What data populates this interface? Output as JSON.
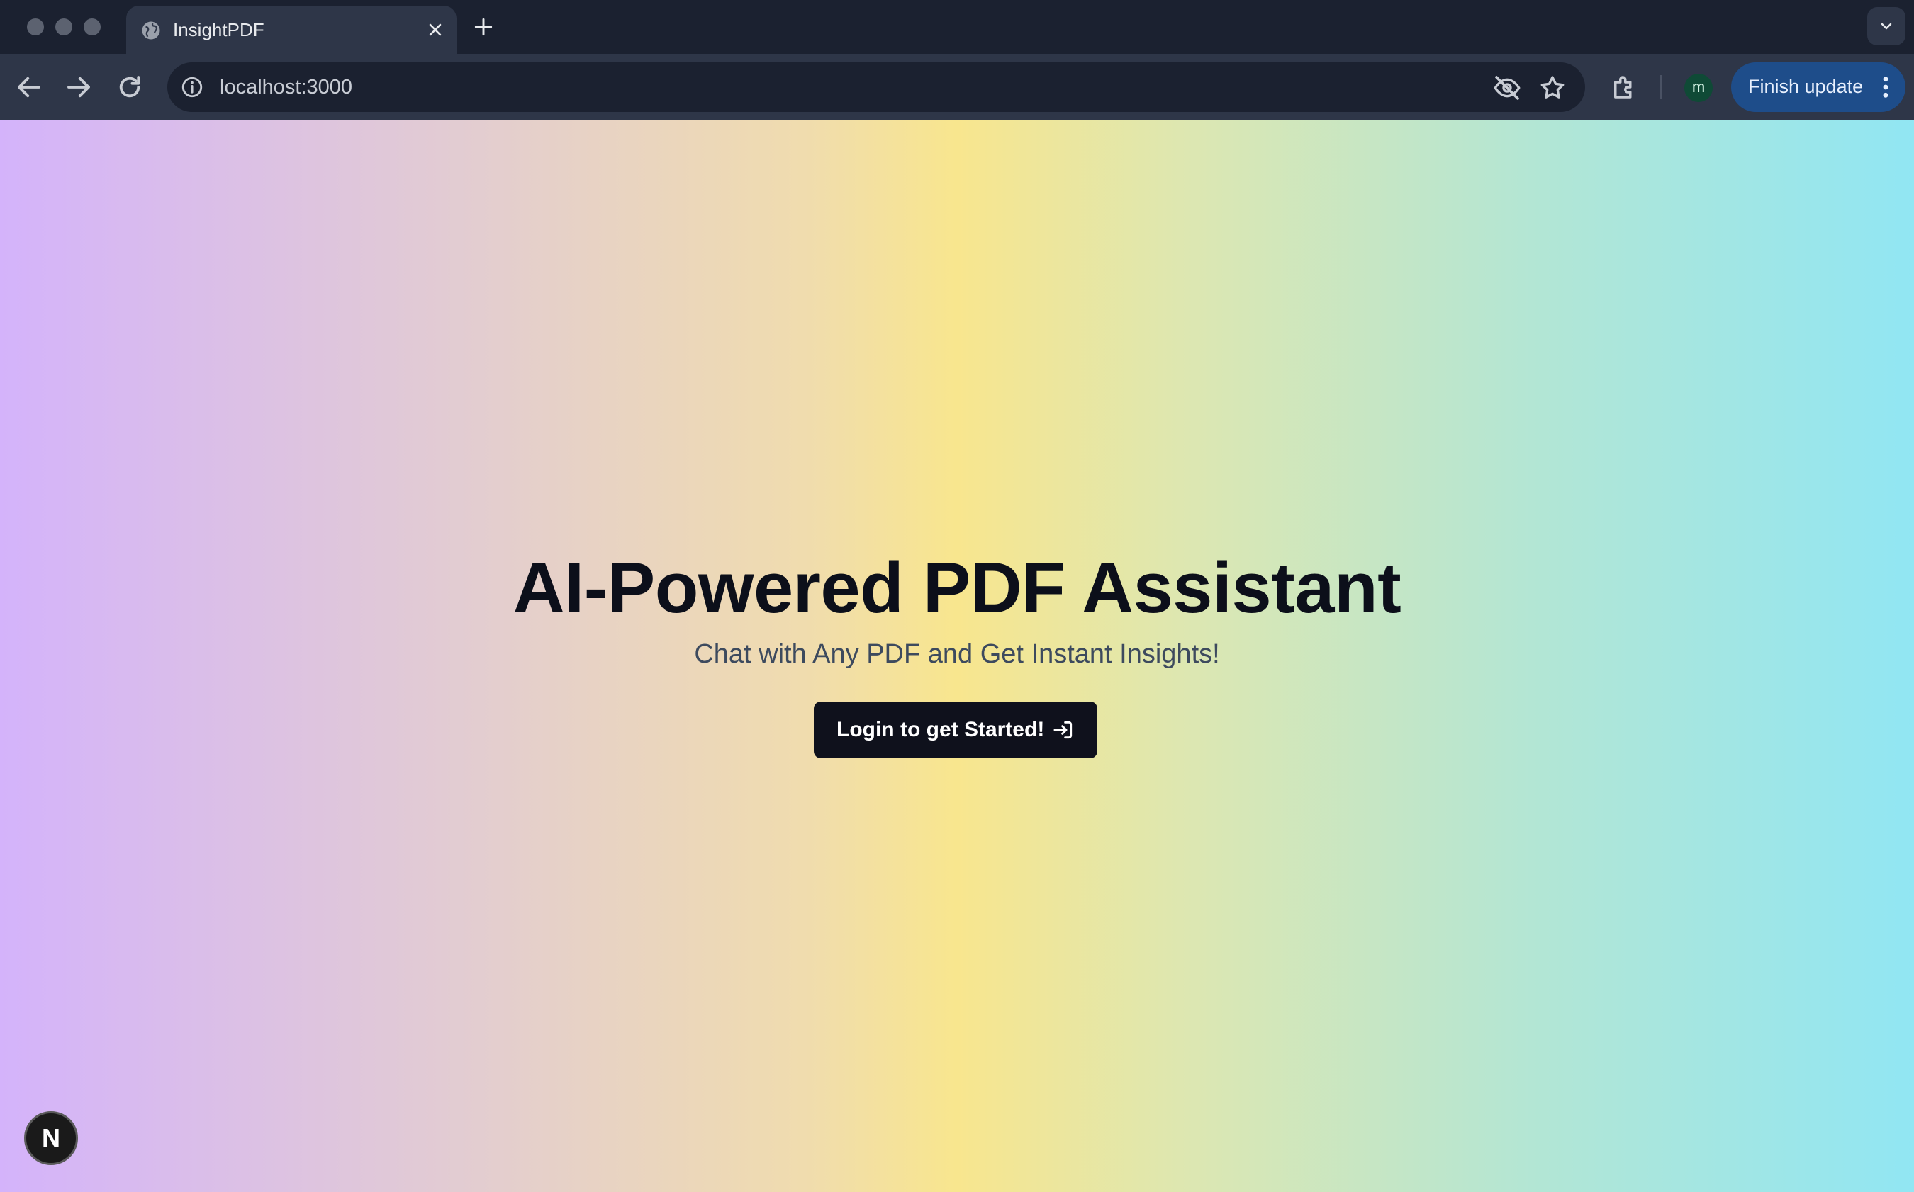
{
  "browser": {
    "tab": {
      "title": "InsightPDF",
      "favicon": "globe-icon"
    },
    "address_bar": {
      "url": "localhost:3000"
    },
    "toolbar": {
      "finish_update_label": "Finish update",
      "profile_initial": "m"
    }
  },
  "page": {
    "hero": {
      "title": "AI-Powered PDF Assistant",
      "subtitle": "Chat with Any PDF and Get Instant Insights!"
    },
    "cta": {
      "label": "Login to get Started!",
      "icon": "login-icon"
    },
    "dev_badge": {
      "label": "N"
    }
  },
  "colors": {
    "chrome_dark": "#1b2130",
    "chrome_toolbar": "#2e3648",
    "gradient": [
      "#d4b3fb",
      "#e3cdd0",
      "#f0dcae",
      "#f8e68e",
      "#dde7b1",
      "#b3e6d4",
      "#91e6f3"
    ],
    "button_bg": "#0f111c",
    "title_text": "#0c0f1a",
    "subtitle_text": "#3d4a5e",
    "finish_update_bg": "#1e4d8a"
  }
}
